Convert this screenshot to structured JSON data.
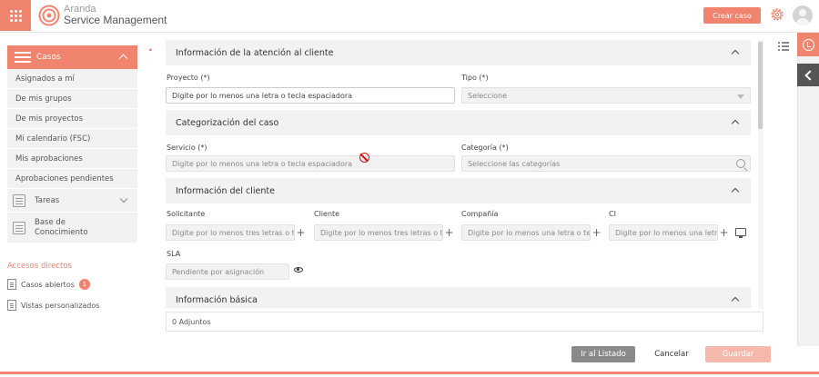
{
  "header": {
    "brand_line1": "Aranda",
    "brand_line2": "Service Management",
    "create_case_label": "Crear caso",
    "accent_color": "#f0846e"
  },
  "sidebar": {
    "section_label": "Casos",
    "items": [
      {
        "label": "Asignados a mí"
      },
      {
        "label": "De mis grupos"
      },
      {
        "label": "De mis proyectos"
      },
      {
        "label": "Mi calendario (FSC)"
      },
      {
        "label": "Mis aprobaciones"
      },
      {
        "label": "Aprobaciones pendientes"
      }
    ],
    "tareas_label": "Tareas",
    "knowledge_label": "Base de Conocimiento",
    "accesos_title": "Accesos directos",
    "shortcuts": [
      {
        "label": "Casos abiertos",
        "badge": "1"
      },
      {
        "label": "Vistas personalizados"
      }
    ]
  },
  "form": {
    "section_attention": "Información de la atención al cliente",
    "proyecto_label": "Proyecto (*)",
    "proyecto_value": "Digite por lo menos una letra o tecla espaciadora",
    "tipo_label": "Tipo (*)",
    "tipo_value": "Seleccione",
    "section_category": "Categorización del caso",
    "servicio_label": "Servicio (*)",
    "servicio_placeholder": "Digite por lo menos una letra o tecla espaciadora",
    "categoria_label": "Categoría (*)",
    "categoria_placeholder": "Seleccione las categorías",
    "section_client": "Información del cliente",
    "solicitante_label": "Solicitante",
    "solicitante_placeholder": "Digite por lo menos tres letras o t...",
    "cliente_label": "Cliente",
    "cliente_placeholder": "Digite por lo menos tres letras o t...",
    "compania_label": "Compañía",
    "compania_placeholder": "Digite por lo menos una letra o te...",
    "ci_label": "CI",
    "ci_placeholder": "Digite por lo menos una letr...",
    "sla_label": "SLA",
    "sla_placeholder": "Pendiente por asignación",
    "section_basic": "Información básica"
  },
  "attachments_label": "0 Adjuntos",
  "footer": {
    "list_label": "Ir al Listado",
    "cancel_label": "Cancelar",
    "save_label": "Guardar"
  }
}
